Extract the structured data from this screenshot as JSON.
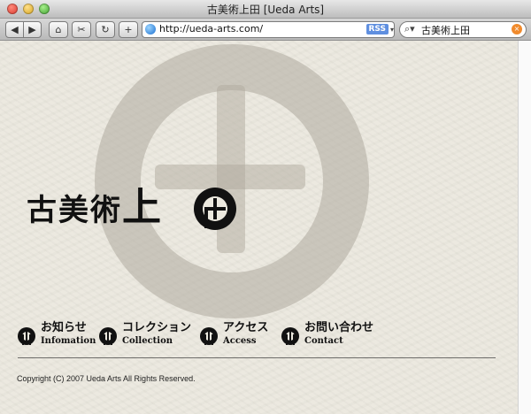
{
  "window": {
    "title": "古美術上田 [Ueda Arts]"
  },
  "toolbar": {
    "url": "http://ueda-arts.com/",
    "rss_label": "RSS",
    "search_query": "古美術上田"
  },
  "page": {
    "logo_text": "古美術",
    "logo_big": "上",
    "nav": [
      {
        "jp": "お知らせ",
        "en": "Infomation"
      },
      {
        "jp": "コレクション",
        "en": "Collection"
      },
      {
        "jp": "アクセス",
        "en": "Access"
      },
      {
        "jp": "お問い合わせ",
        "en": "Contact"
      }
    ],
    "copyright": "Copyright (C) 2007 Ueda Arts All Rights Reserved."
  }
}
